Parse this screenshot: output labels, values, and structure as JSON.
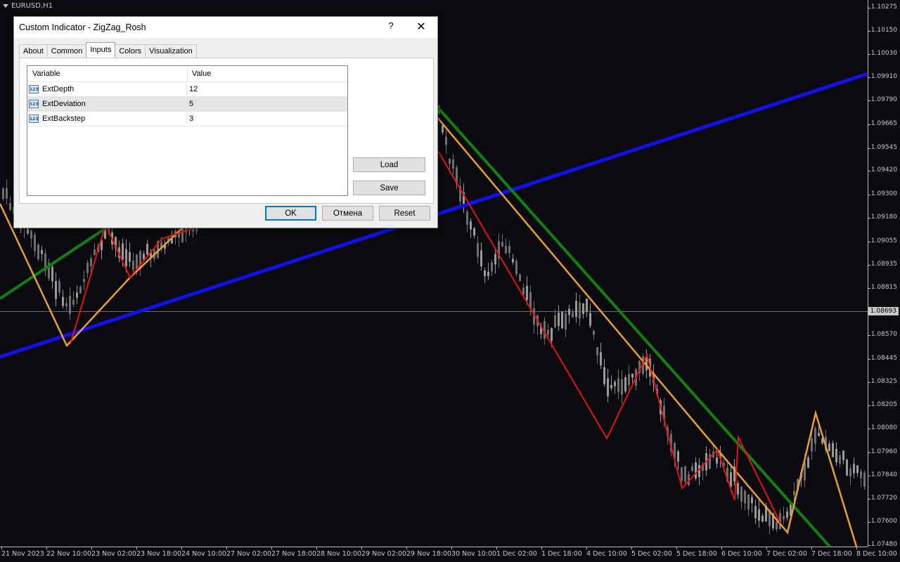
{
  "chart": {
    "symbol": "EURUSD,H1",
    "price_labels": [
      "1.10275",
      "1.10150",
      "1.10030",
      "1.09910",
      "1.09790",
      "1.09665",
      "1.09545",
      "1.09420",
      "1.09300",
      "1.09180",
      "1.09055",
      "1.08935",
      "1.08815",
      "1.08570",
      "1.08445",
      "1.08325",
      "1.08205",
      "1.08080",
      "1.07960",
      "1.07840",
      "1.07720",
      "1.07600",
      "1.07480"
    ],
    "current_price": "1.08693",
    "time_labels": [
      "21 Nov 2023",
      "22 Nov 10:00",
      "23 Nov 02:00",
      "23 Nov 18:00",
      "24 Nov 10:00",
      "27 Nov 02:00",
      "27 Nov 18:00",
      "28 Nov 10:00",
      "29 Nov 02:00",
      "29 Nov 18:00",
      "30 Nov 10:00",
      "1 Dec 02:00",
      "1 Dec 18:00",
      "4 Dec 10:00",
      "5 Dec 02:00",
      "5 Dec 18:00",
      "6 Dec 10:00",
      "7 Dec 02:00",
      "7 Dec 18:00",
      "8 Dec 10:00"
    ],
    "colors": {
      "background": "#0b0b0f",
      "candles": "#8a8a8a",
      "zigzag_red": "#e01414",
      "zigzag_orange": "#e8a030",
      "trend_blue": "#1010f0",
      "trend_green": "#108010"
    }
  },
  "dialog": {
    "title": "Custom Indicator - ZigZag_Rosh",
    "help": "?",
    "close": "✕",
    "tabs": [
      "About",
      "Common",
      "Inputs",
      "Colors",
      "Visualization"
    ],
    "active_tab": "Inputs",
    "columns": {
      "variable": "Variable",
      "value": "Value"
    },
    "inputs": [
      {
        "icon": "123",
        "name": "ExtDepth",
        "value": "12"
      },
      {
        "icon": "123",
        "name": "ExtDeviation",
        "value": "5"
      },
      {
        "icon": "123",
        "name": "ExtBackstep",
        "value": "3"
      }
    ],
    "buttons": {
      "load": "Load",
      "save": "Save",
      "ok": "OK",
      "cancel": "Отмена",
      "reset": "Reset"
    }
  }
}
